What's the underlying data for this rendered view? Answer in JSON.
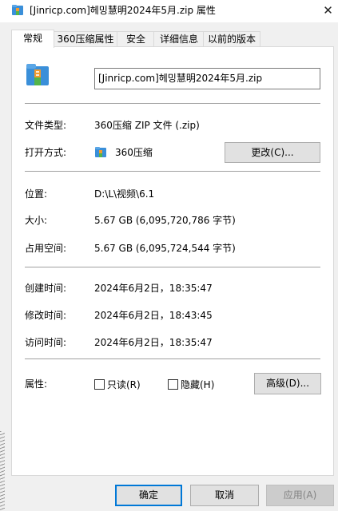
{
  "window": {
    "title": "[Jinricp.com]헤밍慧明2024年5月.zip 属性",
    "close_glyph": "✕"
  },
  "tabs": [
    {
      "label": "常规",
      "active": true
    },
    {
      "label": "360压缩属性",
      "active": false
    },
    {
      "label": "安全",
      "active": false
    },
    {
      "label": "详细信息",
      "active": false
    },
    {
      "label": "以前的版本",
      "active": false
    }
  ],
  "general": {
    "file_name": "[Jinricp.com]헤밍慧明2024年5月.zip",
    "file_type_label": "文件类型:",
    "file_type_value": "360压缩 ZIP 文件 (.zip)",
    "opens_with_label": "打开方式:",
    "opens_with_value": "360压缩",
    "change_button": "更改(C)...",
    "location_label": "位置:",
    "location_value": "D:\\L\\视频\\6.1",
    "size_label": "大小:",
    "size_value": "5.67 GB (6,095,720,786 字节)",
    "size_on_disk_label": "占用空间:",
    "size_on_disk_value": "5.67 GB (6,095,724,544 字节)",
    "created_label": "创建时间:",
    "created_value": "2024年6月2日，18:35:47",
    "modified_label": "修改时间:",
    "modified_value": "2024年6月2日，18:43:45",
    "accessed_label": "访问时间:",
    "accessed_value": "2024年6月2日，18:35:47",
    "attributes_label": "属性:",
    "readonly_label": "只读(R)",
    "hidden_label": "隐藏(H)",
    "advanced_button": "高级(D)..."
  },
  "footer": {
    "ok_button": "确定",
    "cancel_button": "取消",
    "apply_button": "应用(A)"
  },
  "colors": {
    "accent": "#0078d7",
    "icon_blue": "#3a8fd9",
    "icon_orange": "#f29a2e",
    "icon_green": "#53b44a"
  }
}
